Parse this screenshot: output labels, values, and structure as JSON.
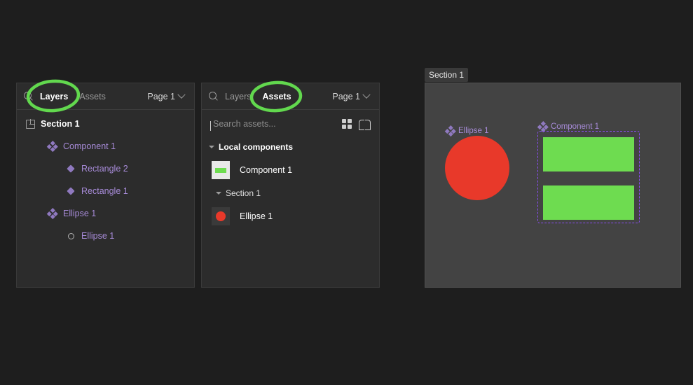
{
  "app": {
    "background": "#1e1e1e",
    "accent_purple": "#a78bd8",
    "selection_purple": "#8a4df0",
    "annotation_green": "#62d84e",
    "green_fill": "#6edc50",
    "red_fill": "#e8392a"
  },
  "layers_panel": {
    "search_icon": "search-icon",
    "tabs": [
      {
        "label": "Layers",
        "active": true
      },
      {
        "label": "Assets",
        "active": false
      }
    ],
    "page_selector": {
      "label": "Page 1",
      "chevron": "chevron-down-icon"
    },
    "tree": [
      {
        "label": "Section 1",
        "level": 0,
        "icon": "section-icon",
        "style": "section"
      },
      {
        "label": "Component 1",
        "level": 1,
        "icon": "component-icon",
        "style": "comp"
      },
      {
        "label": "Rectangle 2",
        "level": 2,
        "icon": "instance-icon",
        "style": "inst"
      },
      {
        "label": "Rectangle 1",
        "level": 2,
        "icon": "instance-icon",
        "style": "inst"
      },
      {
        "label": "Ellipse 1",
        "level": 1,
        "icon": "component-icon",
        "style": "comp"
      },
      {
        "label": "Ellipse 1",
        "level": 2,
        "icon": "ellipse-icon",
        "style": "inst"
      }
    ]
  },
  "assets_panel": {
    "search_icon": "search-icon",
    "tabs": [
      {
        "label": "Layers",
        "active": false
      },
      {
        "label": "Assets",
        "active": true
      }
    ],
    "page_selector": {
      "label": "Page 1",
      "chevron": "chevron-down-icon"
    },
    "search": {
      "placeholder": "Search assets...",
      "value": ""
    },
    "view_toggles": [
      {
        "icon": "grid-view-icon"
      },
      {
        "icon": "library-book-icon"
      }
    ],
    "groups": [
      {
        "title": "Local components",
        "sub": false,
        "items": [
          {
            "name": "Component 1",
            "thumb": "light",
            "shape": "bar",
            "color": "#6edc50"
          }
        ]
      },
      {
        "title": "Section 1",
        "sub": true,
        "items": [
          {
            "name": "Ellipse 1",
            "thumb": "dark",
            "shape": "dot",
            "color": "#e8392a"
          }
        ]
      }
    ]
  },
  "canvas": {
    "section_badge": "Section 1",
    "nodes": [
      {
        "label": "Ellipse 1",
        "icon": "component-icon"
      },
      {
        "label": "Component 1",
        "icon": "component-icon"
      }
    ]
  },
  "annotations": [
    {
      "target": "Layers tab",
      "shape": "hand-drawn-ellipse"
    },
    {
      "target": "Assets tab",
      "shape": "hand-drawn-ellipse"
    }
  ]
}
